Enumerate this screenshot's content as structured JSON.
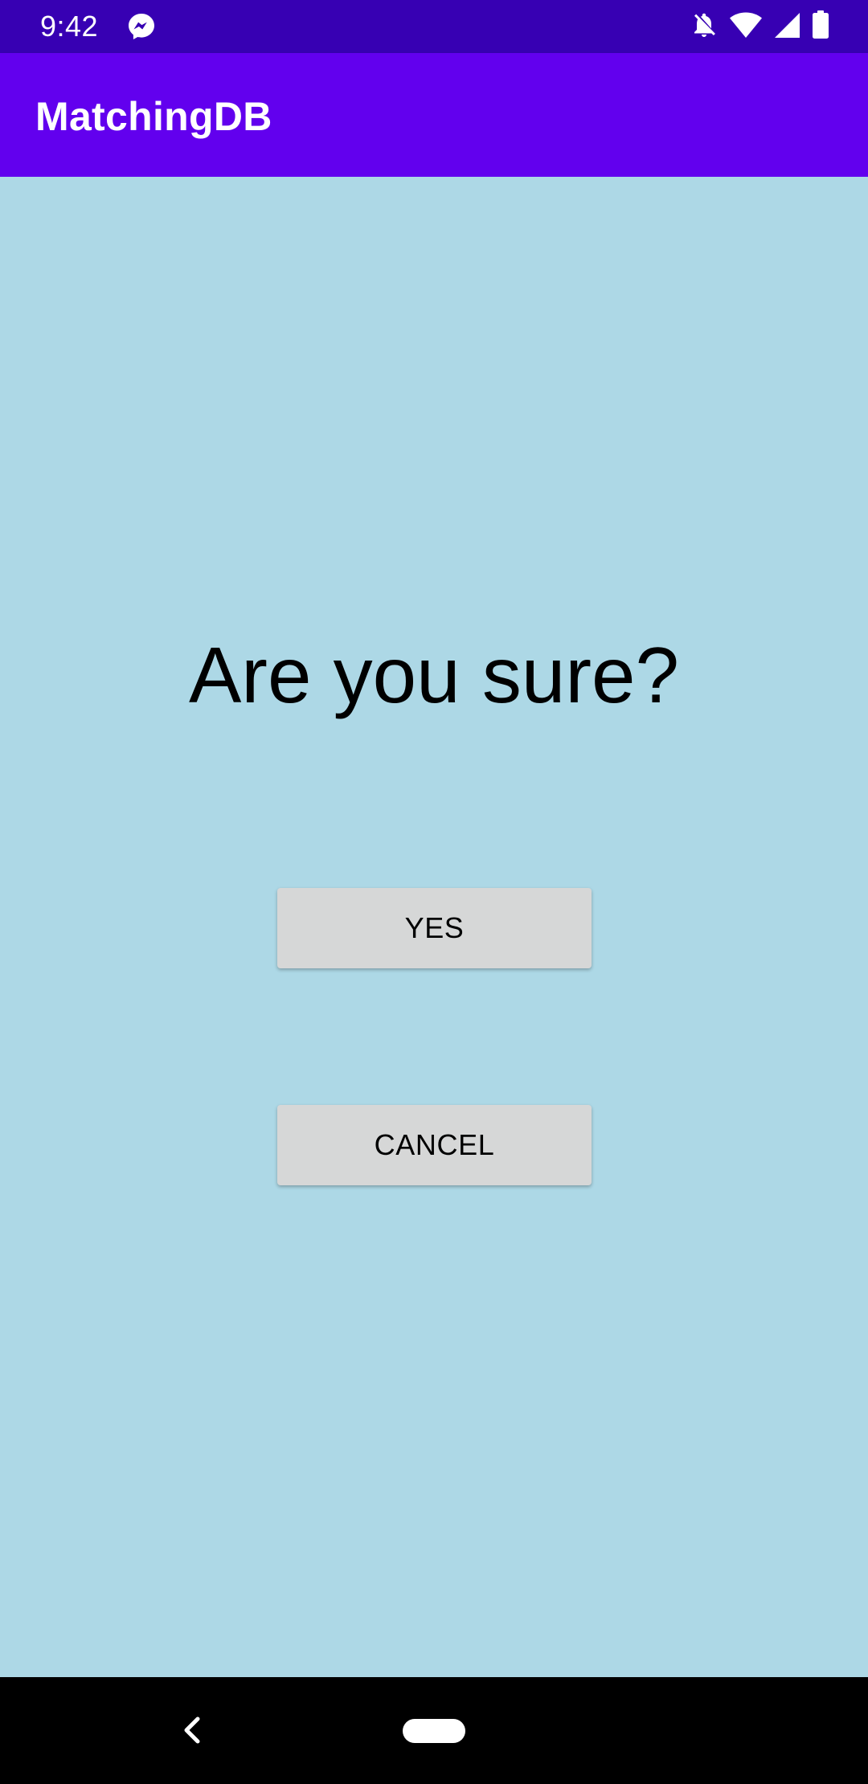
{
  "status_bar": {
    "time": "9:42",
    "icons": [
      "messenger-icon",
      "notifications-off-icon",
      "wifi-icon",
      "cellular-signal-icon",
      "battery-icon"
    ]
  },
  "app_bar": {
    "title": "MatchingDB"
  },
  "dialog": {
    "question": "Are you sure?",
    "yes_label": "YES",
    "cancel_label": "CANCEL"
  },
  "nav_bar": {
    "icons": [
      "back-icon",
      "home-pill-icon"
    ]
  },
  "colors": {
    "status_bar": "#3700b3",
    "app_bar": "#6200ee",
    "background": "#add8e6",
    "button": "#d6d7d7",
    "nav_bar": "#000000"
  }
}
